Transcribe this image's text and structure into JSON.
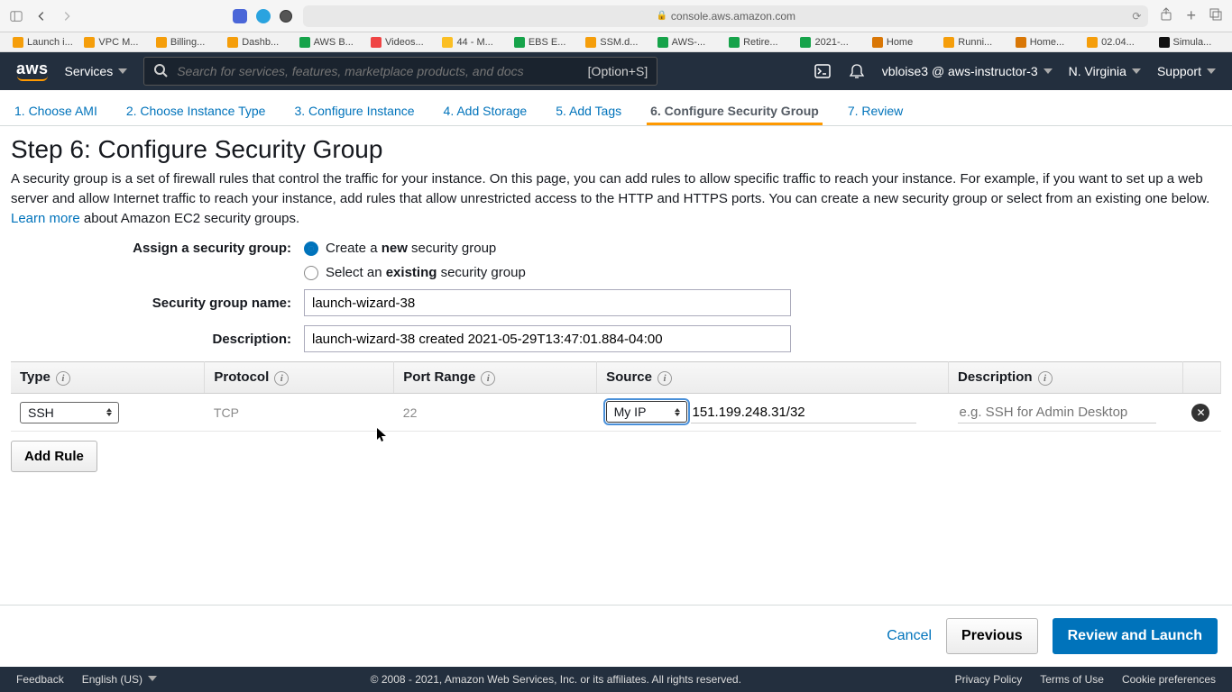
{
  "browser": {
    "url": "console.aws.amazon.com"
  },
  "bookmarks": [
    {
      "label": "Launch i...",
      "color": "#f59e0b"
    },
    {
      "label": "VPC M...",
      "color": "#f59e0b"
    },
    {
      "label": "Billing...",
      "color": "#f59e0b"
    },
    {
      "label": "Dashb...",
      "color": "#f59e0b"
    },
    {
      "label": "AWS B...",
      "color": "#16a34a"
    },
    {
      "label": "Videos...",
      "color": "#ef4444"
    },
    {
      "label": "44 - M...",
      "color": "#fbbf24"
    },
    {
      "label": "EBS E...",
      "color": "#16a34a"
    },
    {
      "label": "SSM.d...",
      "color": "#f59e0b"
    },
    {
      "label": "AWS-...",
      "color": "#16a34a"
    },
    {
      "label": "Retire...",
      "color": "#16a34a"
    },
    {
      "label": "2021-...",
      "color": "#16a34a"
    },
    {
      "label": "Home",
      "color": "#d97706"
    },
    {
      "label": "Runni...",
      "color": "#f59e0b"
    },
    {
      "label": "Home...",
      "color": "#d97706"
    },
    {
      "label": "02.04...",
      "color": "#f59e0b"
    },
    {
      "label": "Simula...",
      "color": "#111111"
    }
  ],
  "nav": {
    "services": "Services",
    "search_placeholder": "Search for services, features, marketplace products, and docs",
    "search_shortcut": "[Option+S]",
    "user": "vbloise3 @ aws-instructor-3",
    "region": "N. Virginia",
    "support": "Support"
  },
  "steps": [
    "1. Choose AMI",
    "2. Choose Instance Type",
    "3. Configure Instance",
    "4. Add Storage",
    "5. Add Tags",
    "6. Configure Security Group",
    "7. Review"
  ],
  "active_step_index": 5,
  "page": {
    "title": "Step 6: Configure Security Group",
    "desc1": "A security group is a set of firewall rules that control the traffic for your instance. On this page, you can add rules to allow specific traffic to reach your instance. For example, if you want to set up a web server and allow Internet traffic to reach your instance, add rules that allow unrestricted access to the HTTP and HTTPS ports. You can create a new security group or select from an existing one below.",
    "learn_more": "Learn more",
    "desc2": " about Amazon EC2 security groups."
  },
  "form": {
    "assign_label": "Assign a security group:",
    "opt_create_pre": "Create a ",
    "opt_create_bold": "new",
    "opt_create_post": " security group",
    "opt_existing_pre": "Select an ",
    "opt_existing_bold": "existing",
    "opt_existing_post": " security group",
    "sg_name_label": "Security group name:",
    "sg_name_value": "launch-wizard-38",
    "sg_desc_label": "Description:",
    "sg_desc_value": "launch-wizard-38 created 2021-05-29T13:47:01.884-04:00"
  },
  "columns": {
    "type": "Type",
    "protocol": "Protocol",
    "port": "Port Range",
    "source": "Source",
    "desc": "Description"
  },
  "rule": {
    "type": "SSH",
    "protocol": "TCP",
    "port": "22",
    "source_mode": "My IP",
    "source_ip": "151.199.248.31/32",
    "desc_placeholder": "e.g. SSH for Admin Desktop"
  },
  "buttons": {
    "add_rule": "Add Rule",
    "cancel": "Cancel",
    "previous": "Previous",
    "review": "Review and Launch"
  },
  "footer": {
    "feedback": "Feedback",
    "language": "English (US)",
    "copyright": "© 2008 - 2021, Amazon Web Services, Inc. or its affiliates. All rights reserved.",
    "privacy": "Privacy Policy",
    "terms": "Terms of Use",
    "cookie": "Cookie preferences"
  }
}
